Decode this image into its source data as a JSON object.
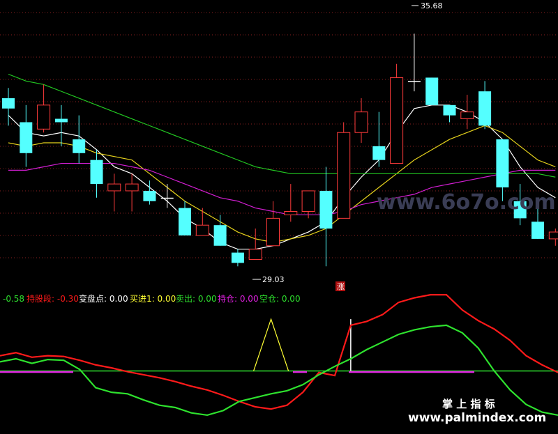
{
  "colors": {
    "background": "#000000",
    "up": "#ff3b3b",
    "down": "#54ffff",
    "flat": "#ffffff",
    "ma_white": "#ffffff",
    "ma_yellow": "#e6d21c",
    "ma_magenta": "#d21ed2",
    "ma_green": "#22c822",
    "indicator_red": "#ff1a1a",
    "indicator_green": "#2ee22e",
    "indicator_yellow": "#ffff33",
    "indicator_magenta": "#e020e0",
    "grid": "#8a2020"
  },
  "chart_data": [
    {
      "type": "candlestick",
      "ylim": [
        28.5,
        36.5
      ],
      "grid": true,
      "candles": [
        {
          "o": 33.8,
          "c": 33.5,
          "h": 34.1,
          "l": 33.0
        },
        {
          "o": 33.1,
          "c": 32.2,
          "h": 33.6,
          "l": 31.8
        },
        {
          "o": 32.9,
          "c": 33.6,
          "h": 34.2,
          "l": 32.8
        },
        {
          "o": 33.2,
          "c": 33.1,
          "h": 33.6,
          "l": 32.4
        },
        {
          "o": 32.6,
          "c": 32.2,
          "h": 33.3,
          "l": 31.9
        },
        {
          "o": 32.0,
          "c": 31.3,
          "h": 32.3,
          "l": 30.9
        },
        {
          "o": 31.1,
          "c": 31.3,
          "h": 31.6,
          "l": 30.5
        },
        {
          "o": 31.1,
          "c": 31.3,
          "h": 31.6,
          "l": 30.5
        },
        {
          "o": 31.1,
          "c": 30.8,
          "h": 31.4,
          "l": 30.7
        },
        {
          "o": 30.9,
          "c": 30.9,
          "h": 31.3,
          "l": 30.6
        },
        {
          "o": 30.6,
          "c": 29.8,
          "h": 30.8,
          "l": 29.8
        },
        {
          "o": 29.8,
          "c": 30.1,
          "h": 30.6,
          "l": 29.8
        },
        {
          "o": 30.1,
          "c": 29.5,
          "h": 30.4,
          "l": 29.5
        },
        {
          "o": 29.3,
          "c": 29.0,
          "h": 29.4,
          "l": 28.9
        },
        {
          "o": 29.1,
          "c": 29.4,
          "h": 30.0,
          "l": 29.1
        },
        {
          "o": 29.5,
          "c": 30.3,
          "h": 30.8,
          "l": 29.5
        },
        {
          "o": 30.4,
          "c": 30.5,
          "h": 31.3,
          "l": 30.2
        },
        {
          "o": 30.5,
          "c": 31.1,
          "h": 31.1,
          "l": 30.3
        },
        {
          "o": 31.1,
          "c": 30.0,
          "h": 31.8,
          "l": 28.9
        },
        {
          "o": 30.3,
          "c": 32.8,
          "h": 33.1,
          "l": 30.3
        },
        {
          "o": 32.8,
          "c": 33.4,
          "h": 33.8,
          "l": 32.5
        },
        {
          "o": 32.4,
          "c": 32.0,
          "h": 33.4,
          "l": 31.8
        },
        {
          "o": 31.9,
          "c": 34.4,
          "h": 34.8,
          "l": 31.9
        },
        {
          "o": 34.3,
          "c": 34.3,
          "h": 35.68,
          "l": 34.0
        },
        {
          "o": 34.4,
          "c": 33.6,
          "h": 34.4,
          "l": 33.6
        },
        {
          "o": 33.6,
          "c": 33.3,
          "h": 33.6,
          "l": 33.1
        },
        {
          "o": 33.2,
          "c": 33.4,
          "h": 33.9,
          "l": 32.9
        },
        {
          "o": 34.0,
          "c": 33.0,
          "h": 34.3,
          "l": 32.9
        },
        {
          "o": 32.6,
          "c": 31.2,
          "h": 32.6,
          "l": 30.8
        },
        {
          "o": 30.8,
          "c": 30.3,
          "h": 31.3,
          "l": 30.1
        },
        {
          "o": 30.2,
          "c": 29.7,
          "h": 30.7,
          "l": 29.7
        },
        {
          "o": 29.7,
          "c": 29.9,
          "h": 30.0,
          "l": 29.5
        }
      ],
      "moving_averages": [
        {
          "color_key": "ma_white",
          "values": [
            33.3,
            32.8,
            32.7,
            32.8,
            32.7,
            32.3,
            31.8,
            31.6,
            31.2,
            30.8,
            30.3,
            30.0,
            29.6,
            29.4,
            29.4,
            29.5,
            29.7,
            29.9,
            30.2,
            30.9,
            31.5,
            32.0,
            32.8,
            33.5,
            33.6,
            33.6,
            33.4,
            33.1,
            32.6,
            31.8,
            31.2,
            30.9
          ]
        },
        {
          "color_key": "ma_yellow",
          "values": [
            32.5,
            32.4,
            32.5,
            32.5,
            32.4,
            32.2,
            32.1,
            32.0,
            31.6,
            31.2,
            30.8,
            30.5,
            30.2,
            29.9,
            29.7,
            29.6,
            29.7,
            29.8,
            30.0,
            30.4,
            30.8,
            31.2,
            31.6,
            32.0,
            32.3,
            32.6,
            32.8,
            33.0,
            32.8,
            32.4,
            32.0,
            31.8
          ]
        },
        {
          "color_key": "ma_magenta",
          "values": [
            31.7,
            31.7,
            31.8,
            31.9,
            31.9,
            31.9,
            31.9,
            31.8,
            31.7,
            31.5,
            31.3,
            31.1,
            30.9,
            30.8,
            30.6,
            30.5,
            30.4,
            30.4,
            30.4,
            30.5,
            30.7,
            30.8,
            30.9,
            31.0,
            31.2,
            31.3,
            31.4,
            31.5,
            31.6,
            31.7,
            31.7,
            31.7
          ]
        },
        {
          "color_key": "ma_green",
          "values": [
            34.5,
            34.3,
            34.2,
            34.0,
            33.8,
            33.6,
            33.4,
            33.2,
            33.0,
            32.8,
            32.6,
            32.4,
            32.2,
            32.0,
            31.8,
            31.7,
            31.6,
            31.6,
            31.6,
            31.6,
            31.6,
            31.6,
            31.6,
            31.6,
            31.6,
            31.6,
            31.6,
            31.6,
            31.6,
            31.6,
            31.6,
            31.5
          ]
        }
      ],
      "annotations": {
        "high_label": "35.68",
        "low_label": "29.03",
        "signal_label": "涨"
      }
    },
    {
      "type": "line",
      "ylim": [
        -0.8,
        0.8
      ],
      "legend": [
        {
          "text": "-0.58",
          "color_key": "indicator_green"
        },
        {
          "text": "持股段: -0.30",
          "color_key": "indicator_red"
        },
        {
          "text": "变盘点: 0.00",
          "color_key": "flat"
        },
        {
          "text": "买进1: 0.00",
          "color_key": "indicator_yellow"
        },
        {
          "text": "卖出: 0.00",
          "color_key": "indicator_green"
        },
        {
          "text": "持仓: 0.00",
          "color_key": "indicator_magenta"
        },
        {
          "text": "空仓: 0.00",
          "color_key": "indicator_green"
        }
      ],
      "series": [
        {
          "color_key": "indicator_red",
          "values": [
            0.2,
            0.24,
            0.18,
            0.2,
            0.19,
            0.14,
            0.08,
            0.04,
            -0.01,
            -0.05,
            -0.09,
            -0.14,
            -0.2,
            -0.25,
            -0.32,
            -0.4,
            -0.47,
            -0.5,
            -0.45,
            -0.28,
            -0.02,
            -0.06,
            0.6,
            0.65,
            0.74,
            0.9,
            0.96,
            1.0,
            1.0,
            0.8,
            0.66,
            0.55,
            0.4,
            0.2,
            0.08,
            -0.02
          ]
        },
        {
          "color_key": "indicator_green",
          "values": [
            0.12,
            0.16,
            0.1,
            0.15,
            0.14,
            0.02,
            -0.22,
            -0.28,
            -0.3,
            -0.38,
            -0.45,
            -0.48,
            -0.55,
            -0.58,
            -0.52,
            -0.4,
            -0.35,
            -0.3,
            -0.26,
            -0.18,
            -0.05,
            0.06,
            0.16,
            0.28,
            0.38,
            0.48,
            0.54,
            0.58,
            0.6,
            0.5,
            0.3,
            0.0,
            -0.25,
            -0.44,
            -0.54,
            -0.58
          ]
        }
      ],
      "spikes": [
        {
          "index": 17,
          "value": 0.68,
          "color_key": "indicator_yellow"
        },
        {
          "index": 22,
          "value": 0.68,
          "color_key": "flat"
        }
      ]
    }
  ],
  "watermarks": {
    "top": "www.6o7o.com",
    "cn": "掌 上 指 标",
    "url": "www.palmindex.com"
  }
}
